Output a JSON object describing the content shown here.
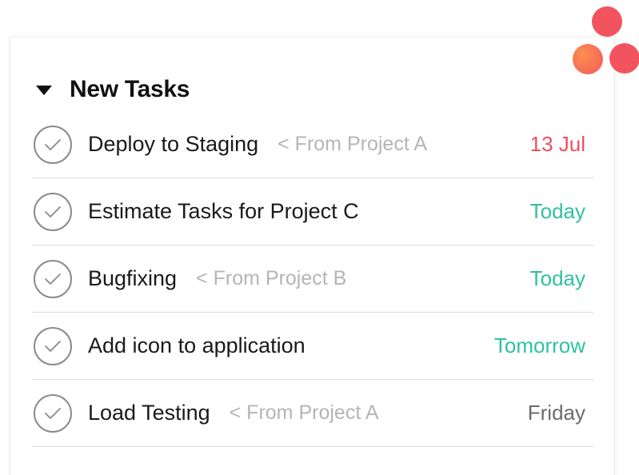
{
  "colors": {
    "accent": "#f2545f",
    "due_overdue": "#ef4f5e",
    "due_soon": "#2fc2a1",
    "due_later": "#6b6b6b",
    "project_text": "#b5b5b5"
  },
  "logo": {
    "icon": "asana-logo"
  },
  "section": {
    "title": "New Tasks",
    "toggle_icon": "caret-down-icon"
  },
  "tasks": [
    {
      "name": "Deploy to Staging",
      "project": "< From Project A",
      "due": "13 Jul",
      "due_status": "overdue"
    },
    {
      "name": "Estimate Tasks for Project C",
      "project": "",
      "due": "Today",
      "due_status": "soon"
    },
    {
      "name": "Bugfixing",
      "project": "< From Project B",
      "due": "Today",
      "due_status": "soon"
    },
    {
      "name": "Add icon to application",
      "project": "",
      "due": "Tomorrow",
      "due_status": "soon"
    },
    {
      "name": "Load Testing",
      "project": "< From Project A",
      "due": "Friday",
      "due_status": "later"
    }
  ]
}
